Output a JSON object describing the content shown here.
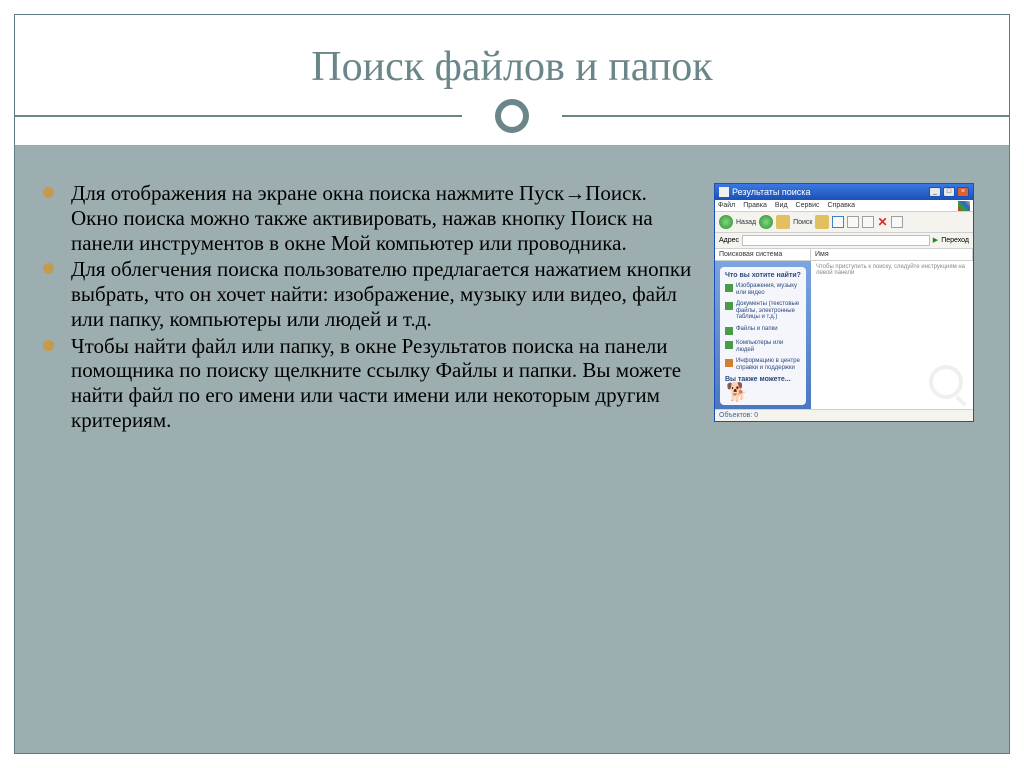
{
  "title": "Поиск файлов и папок",
  "bullets": [
    "Для отображения на экране окна поиска нажмите Пуск→Поиск. Окно поиска можно также активировать, нажав кнопку Поиск на панели инструментов в окне Мой компьютер или проводника.",
    "Для облегчения поиска пользователю предлагается нажатием кнопки выбрать, что он хочет найти: изображение, музыку или видео, файл или папку, компьютеры или людей и т.д.",
    "Чтобы найти файл или папку, в окне Результатов поиска на панели помощника по поиску щелкните ссылку Файлы и папки. Вы можете найти файл по его имени или части имени или некоторым другим критериям."
  ],
  "xp": {
    "title": "Результаты поиска",
    "menu": [
      "Файл",
      "Правка",
      "Вид",
      "Сервис",
      "Справка"
    ],
    "toolbar": {
      "back": "Назад",
      "search": "Поиск"
    },
    "addr_label": "Адрес",
    "go": "Переход",
    "col1": "Поисковая система",
    "col2": "Имя",
    "side_title": "Что вы хотите найти?",
    "side_items": [
      "Изображения, музыку или видео",
      "Документы (текстовые файлы, электронные таблицы и т.д.)",
      "Файлы и папки",
      "Компьютеры или людей",
      "Информацию в центре справки и поддержки"
    ],
    "also": "Вы также можете...",
    "hint": "Чтобы приступить к поиску, следуйте инструкциям на левой панели",
    "status": "Объектов: 0"
  }
}
